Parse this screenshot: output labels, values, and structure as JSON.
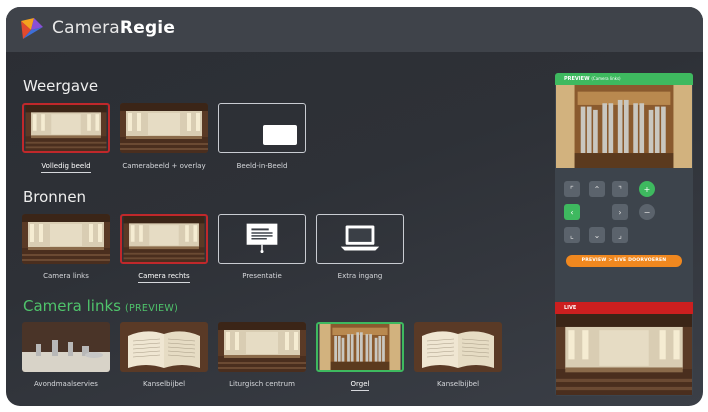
{
  "app": {
    "title_light": "Camera",
    "title_bold": "Regie"
  },
  "weergave": {
    "title": "Weergave",
    "items": [
      {
        "label": "Volledig beeld",
        "selected": true
      },
      {
        "label": "Camerabeeld + overlay",
        "selected": false
      },
      {
        "label": "Beeld-in-Beeld",
        "selected": false
      }
    ]
  },
  "bronnen": {
    "title": "Bronnen",
    "items": [
      {
        "label": "Camera links",
        "selected": false
      },
      {
        "label": "Camera rechts",
        "selected": true
      },
      {
        "label": "Presentatie",
        "selected": false
      },
      {
        "label": "Extra ingang",
        "selected": false
      }
    ]
  },
  "camera": {
    "title": "Camera links",
    "subtitle": "(PREVIEW)",
    "presets": [
      {
        "label": "Avondmaalservies",
        "selected": false
      },
      {
        "label": "Kanselbijbel",
        "selected": false
      },
      {
        "label": "Liturgisch centrum",
        "selected": false
      },
      {
        "label": "Orgel",
        "selected": true
      },
      {
        "label": "Kanselbijbel",
        "selected": false
      }
    ]
  },
  "panel": {
    "preview_label": "PREVIEW",
    "preview_source": "(Camera links)",
    "live_label": "LIVE",
    "cta_label": "PREVIEW > LIVE DOORVOEREN",
    "ptz": {
      "up_left": "⌜",
      "up": "⌃",
      "up_right": "⌝",
      "zoom_in": "+",
      "left": "‹",
      "right": "›",
      "zoom_out": "−",
      "down_left": "⌞",
      "down": "⌄",
      "down_right": "⌟"
    }
  },
  "colors": {
    "accent_green": "#3eb95f",
    "selected_red": "#c0282b",
    "cta_orange": "#f0881f",
    "live_red": "#cc1f1f"
  }
}
